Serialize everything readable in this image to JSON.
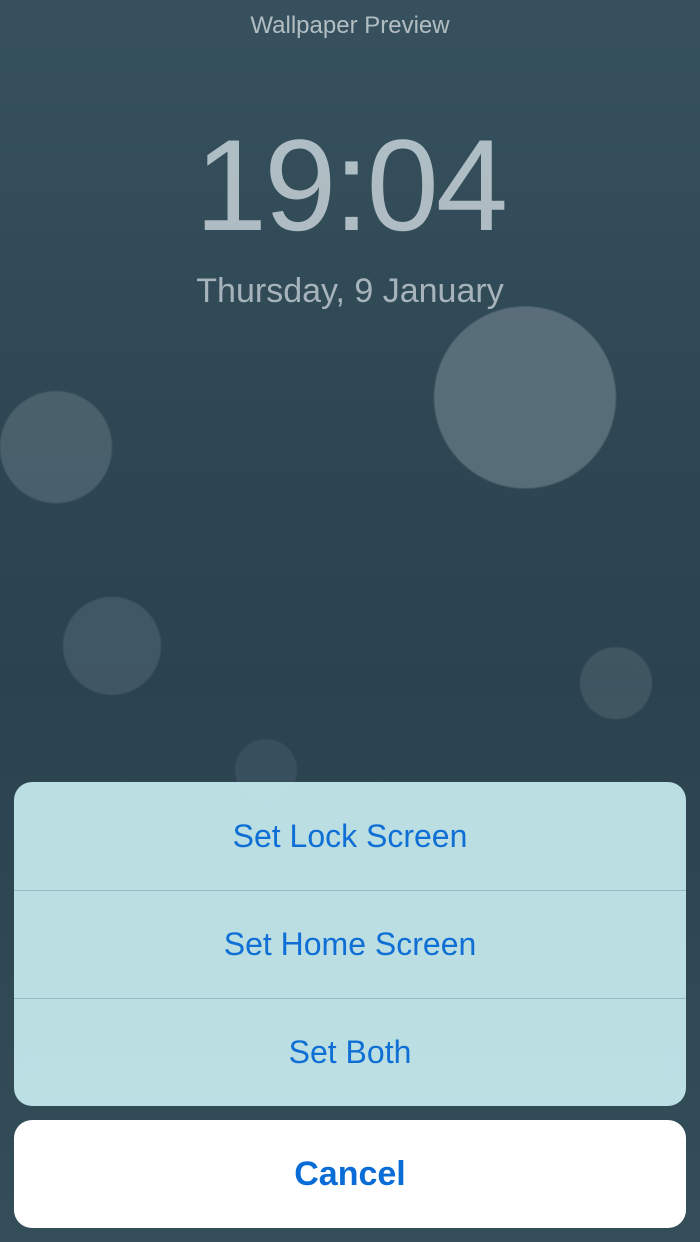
{
  "header": {
    "title": "Wallpaper Preview"
  },
  "lockscreen": {
    "time": "19:04",
    "date": "Thursday, 9 January"
  },
  "actionSheet": {
    "options": [
      {
        "label": "Set Lock Screen"
      },
      {
        "label": "Set Home Screen"
      },
      {
        "label": "Set Both"
      }
    ],
    "cancel": "Cancel"
  },
  "colors": {
    "accent": "#0f6fd4",
    "sheetBg": "#c8ebf0",
    "wallpaperBase": "#335260"
  }
}
